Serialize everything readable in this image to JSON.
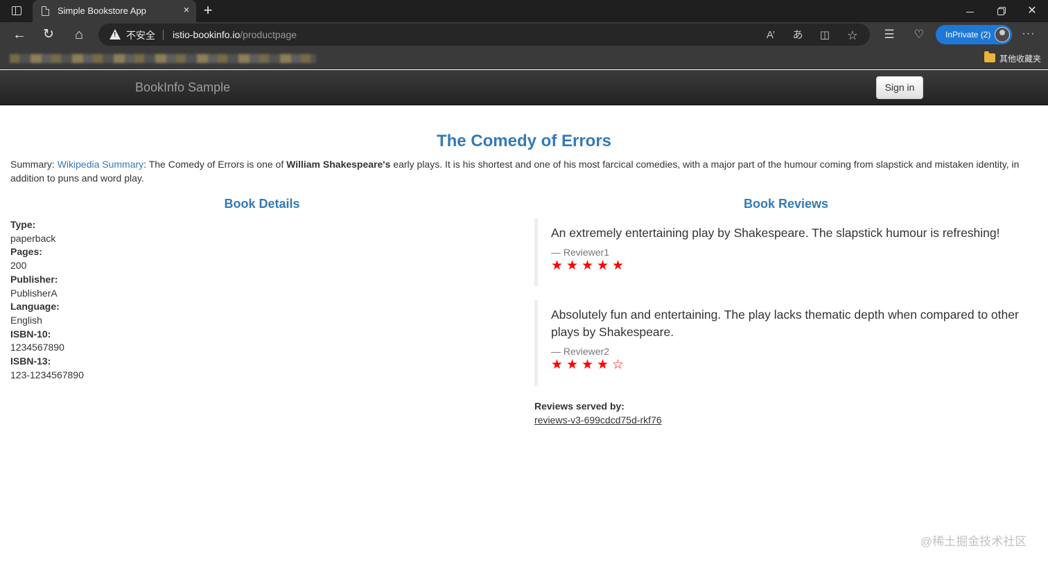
{
  "browser": {
    "tab_title": "Simple Bookstore App",
    "tab_close_icon": "×",
    "new_tab_icon": "+",
    "window_controls": {
      "close": "✕"
    },
    "security_warning": "不安全",
    "url_host": "istio-bookinfo.io",
    "url_path": "/productpage",
    "address_icons": {
      "read_aloud": "A’",
      "translate": "あ",
      "split": "◫",
      "favorite": "☆"
    },
    "toolbar_icons": {
      "favorites": "☰",
      "health": "♡",
      "more": "···",
      "back": "←",
      "reload": "↻",
      "home": "⌂"
    },
    "inprivate_label": "InPrivate (2)",
    "other_favorites": "其他收藏夹"
  },
  "navbar": {
    "brand": "BookInfo Sample",
    "signin_label": "Sign in"
  },
  "product": {
    "title": "The Comedy of Errors",
    "summary_prefix": "Summary: ",
    "summary_link": "Wikipedia Summary",
    "summary_text_1": ": The Comedy of Errors is one of ",
    "summary_author": "William Shakespeare's",
    "summary_text_2": " early plays. It is his shortest and one of his most farcical comedies, with a major part of the humour coming from slapstick and mistaken identity, in addition to puns and word play."
  },
  "details": {
    "heading": "Book Details",
    "fields": [
      {
        "label": "Type:",
        "value": "paperback"
      },
      {
        "label": "Pages:",
        "value": "200"
      },
      {
        "label": "Publisher:",
        "value": "PublisherA"
      },
      {
        "label": "Language:",
        "value": "English"
      },
      {
        "label": "ISBN-10:",
        "value": "1234567890"
      },
      {
        "label": "ISBN-13:",
        "value": "123-1234567890"
      }
    ]
  },
  "reviews": {
    "heading": "Book Reviews",
    "items": [
      {
        "text": "An extremely entertaining play by Shakespeare. The slapstick humour is refreshing!",
        "author": "— Reviewer1",
        "rating": 5,
        "max_rating": 5,
        "star_color": "#ff0000"
      },
      {
        "text": "Absolutely fun and entertaining. The play lacks thematic depth when compared to other plays by Shakespeare.",
        "author": "— Reviewer2",
        "rating": 4,
        "max_rating": 5,
        "star_color": "#ff0000"
      }
    ],
    "served_by_label": "Reviews served by:",
    "served_by_host": "reviews-v3-699cdcd75d-rkf76"
  },
  "watermark": "@稀土掘金技术社区",
  "colors": {
    "link": "#337ab7",
    "star": "#ff0000",
    "inprivate": "#1e78d7"
  }
}
